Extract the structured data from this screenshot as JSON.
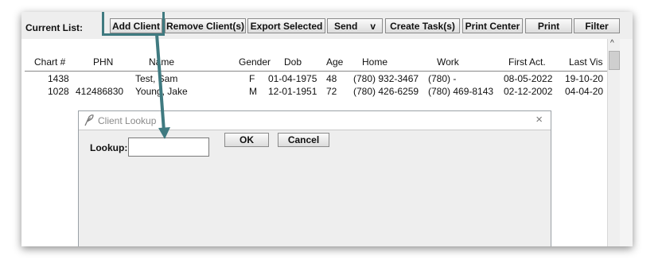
{
  "toolbar": {
    "current_list_label": "Current List:",
    "buttons": [
      "Add Client",
      "Remove Client(s)",
      "Export Selected",
      "Send",
      "Create Task(s)",
      "Print Center",
      "Print",
      "Filter"
    ],
    "send_caret": "v"
  },
  "table": {
    "columns": [
      "Chart #",
      "PHN",
      "Name",
      "Gender",
      "Dob",
      "Age",
      "Home",
      "Work",
      "First Act.",
      "Last Vis"
    ],
    "rows": [
      [
        "1438",
        "",
        "Test, Sam",
        "F",
        "01-04-1975",
        "48",
        "(780) 932-3467",
        "(780)  -",
        "08-05-2022",
        "19-10-20"
      ],
      [
        "1028",
        "412486830",
        "Young, Jake",
        "M",
        "12-01-1951",
        "72",
        "(780) 426-6259",
        "(780) 469-8143",
        "02-12-2002",
        "04-04-20"
      ]
    ]
  },
  "scrollbar": {
    "up_arrow": "^"
  },
  "dialog": {
    "title": "Client Lookup",
    "close": "×",
    "lookup_label": "Lookup:",
    "lookup_value": "",
    "ok_label": "OK",
    "cancel_label": "Cancel"
  },
  "colors": {
    "highlight": "#3f7a80"
  }
}
